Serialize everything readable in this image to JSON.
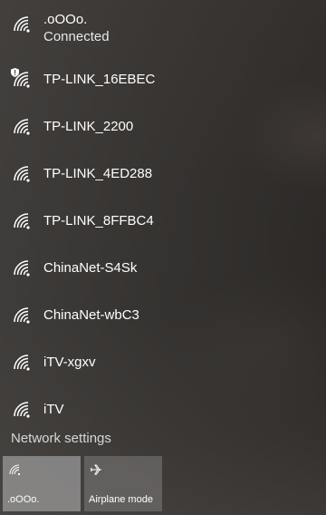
{
  "networks": [
    {
      "name": ".oOOo.",
      "status": "Connected",
      "icon": "wifi-signal-icon"
    },
    {
      "name": "TP-LINK_16EBEC",
      "icon": "wifi-secured-icon"
    },
    {
      "name": "TP-LINK_2200",
      "icon": "wifi-signal-icon"
    },
    {
      "name": "TP-LINK_4ED288",
      "icon": "wifi-signal-icon"
    },
    {
      "name": "TP-LINK_8FFBC4",
      "icon": "wifi-signal-icon"
    },
    {
      "name": "ChinaNet-S4Sk",
      "icon": "wifi-signal-icon"
    },
    {
      "name": "ChinaNet-wbC3",
      "icon": "wifi-signal-icon"
    },
    {
      "name": "iTV-xgxv",
      "icon": "wifi-signal-icon"
    },
    {
      "name": "iTV",
      "icon": "wifi-signal-icon"
    }
  ],
  "footer": {
    "network_settings": "Network settings"
  },
  "tiles": [
    {
      "label": ".oOOo.",
      "icon": "wifi-icon",
      "active": true
    },
    {
      "label": "Airplane mode",
      "icon": "airplane-icon",
      "active": false
    }
  ]
}
